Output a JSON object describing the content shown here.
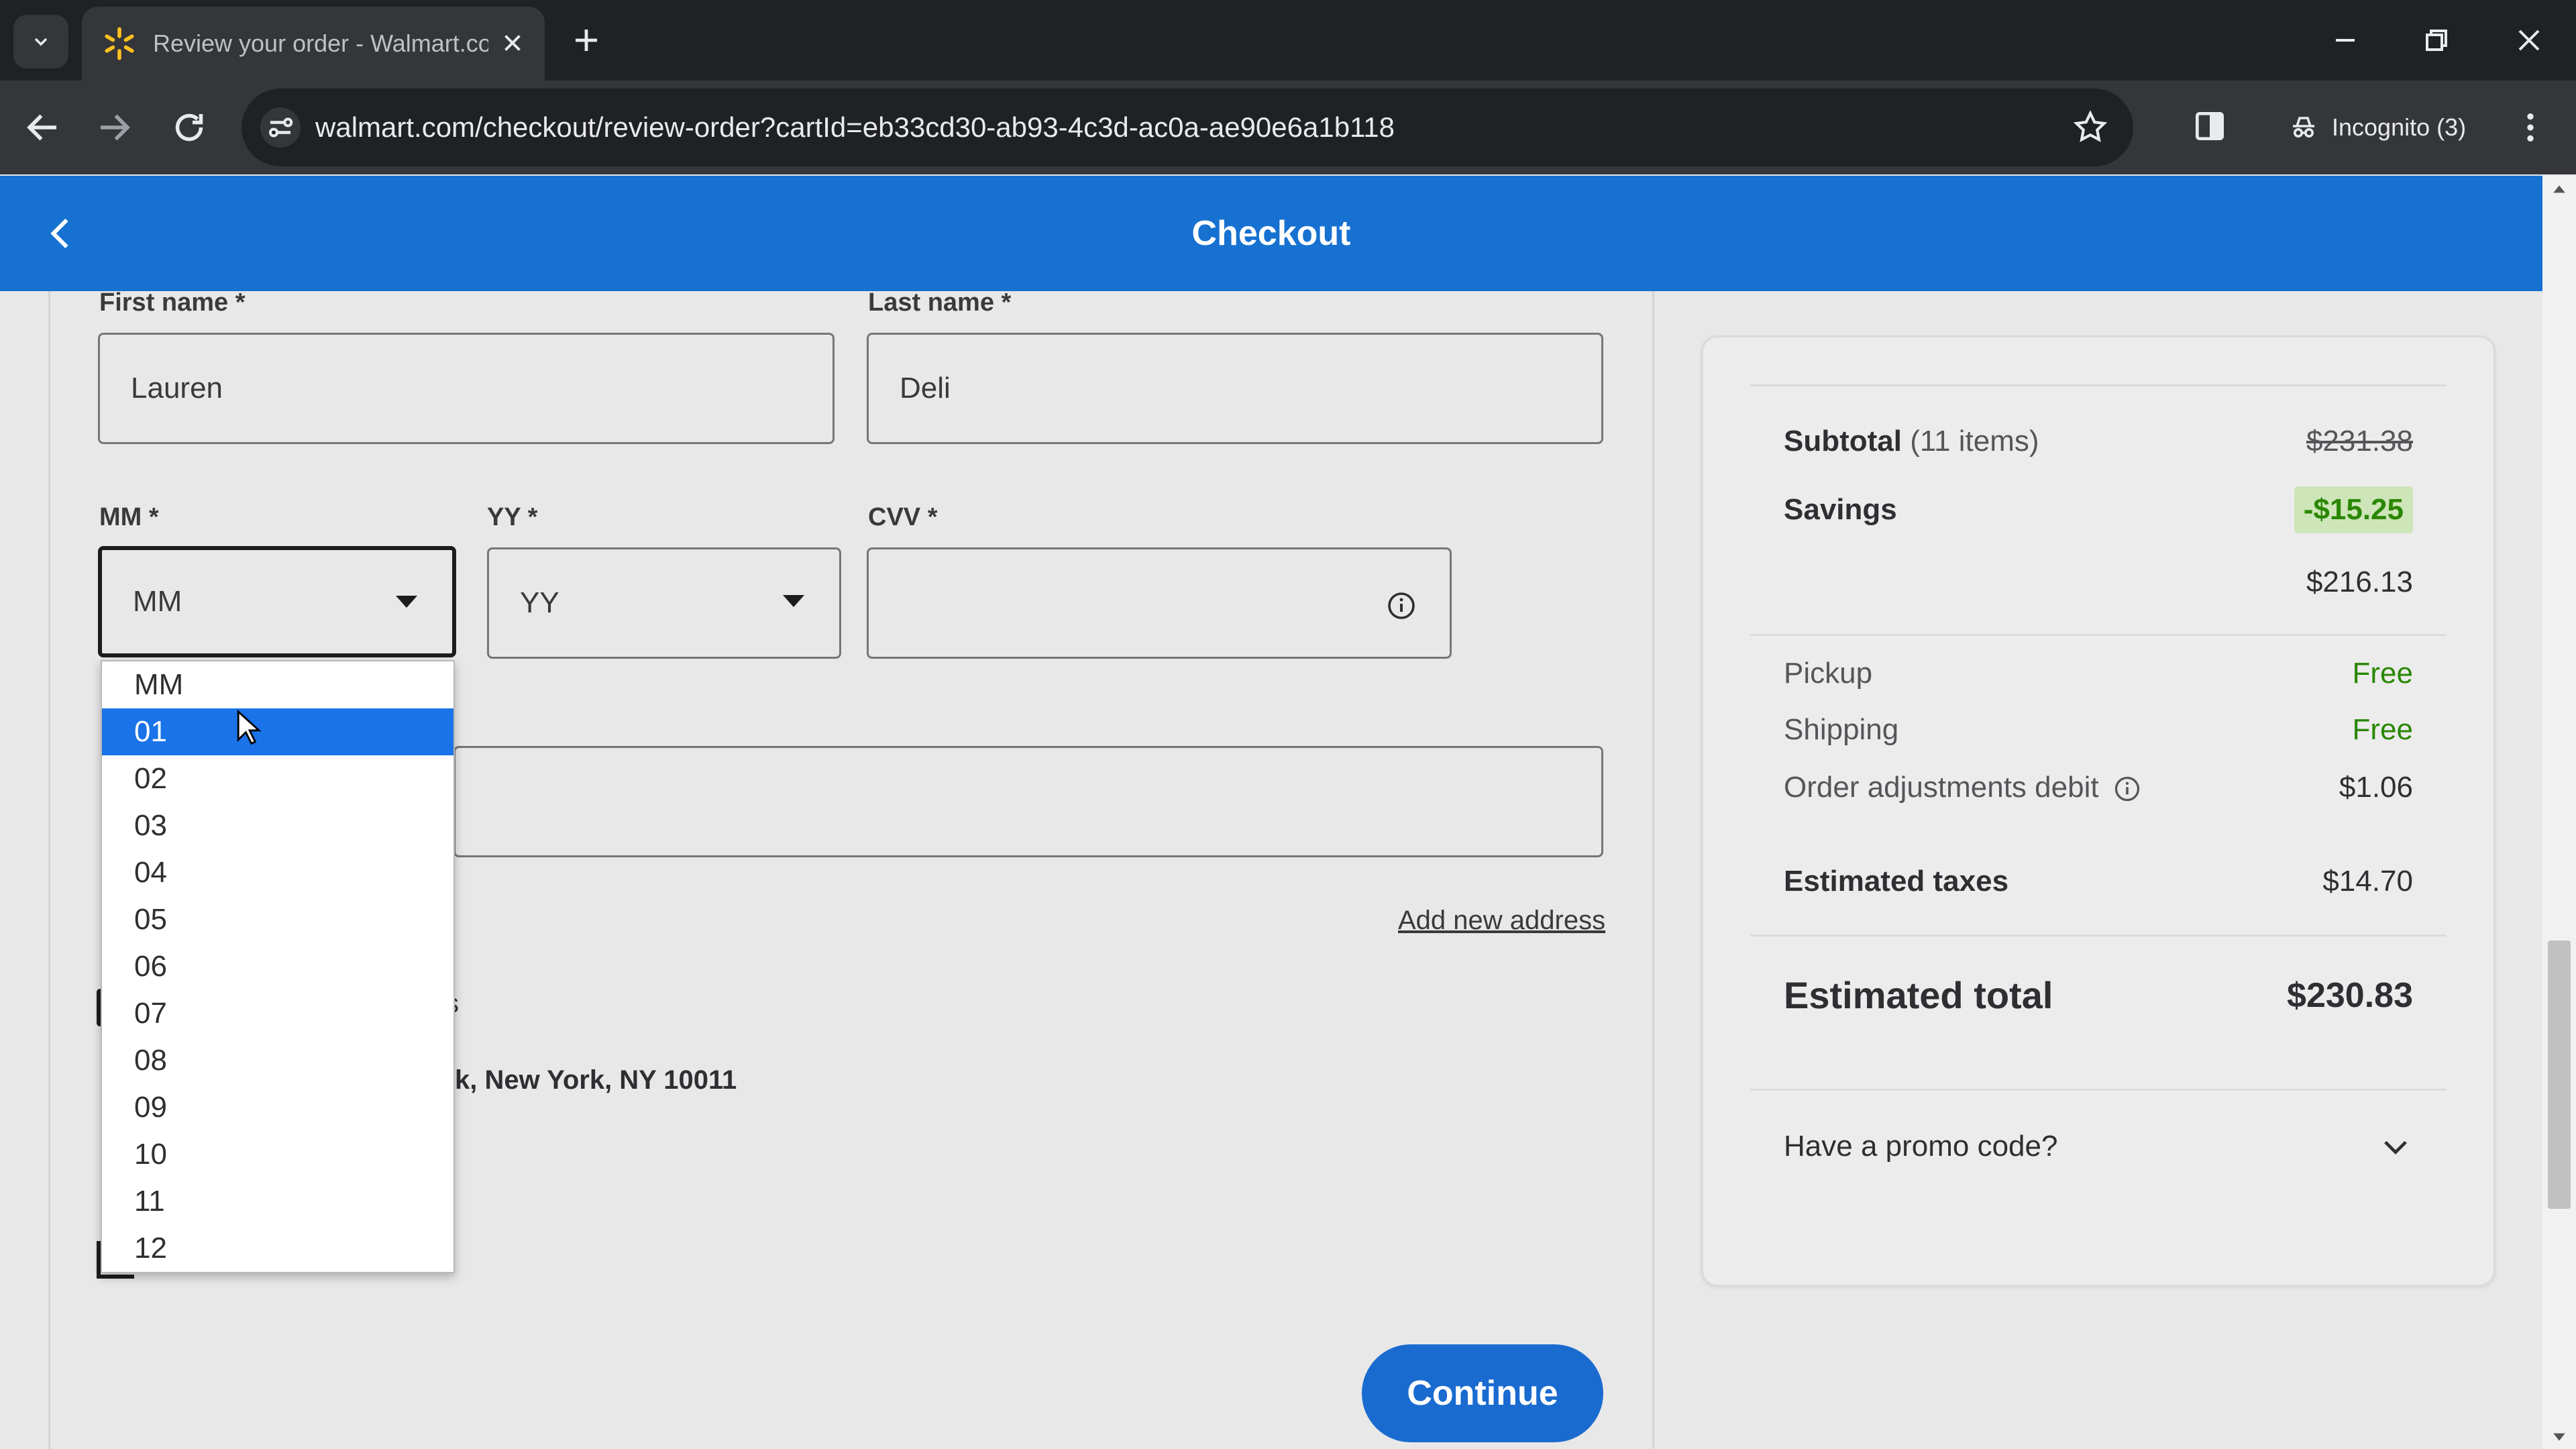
{
  "browser": {
    "tab_title": "Review your order - Walmart.com",
    "url": "walmart.com/checkout/review-order?cartId=eb33cd30-ab93-4c3d-ac0a-ae90e6a1b118",
    "incognito_label": "Incognito (3)"
  },
  "header": {
    "title": "Checkout"
  },
  "form": {
    "first_name_label": "First name *",
    "first_name_value": "Lauren",
    "last_name_label": "Last name *",
    "last_name_value": "Deli",
    "mm_label": "MM *",
    "mm_value": "MM",
    "yy_label": "YY *",
    "yy_value": "YY",
    "cvv_label": "CVV *",
    "cvv_value": "",
    "add_address_link": "Add new address",
    "address_fragment_1": "s",
    "address_fragment_2": "k, New York, NY 10011",
    "continue_label": "Continue"
  },
  "month_dropdown": {
    "options": [
      "MM",
      "01",
      "02",
      "03",
      "04",
      "05",
      "06",
      "07",
      "08",
      "09",
      "10",
      "11",
      "12"
    ],
    "highlighted": "01"
  },
  "summary": {
    "subtotal_label": "Subtotal",
    "subtotal_items": "(11 items)",
    "subtotal_value": "$231.38",
    "savings_label": "Savings",
    "savings_value": "-$15.25",
    "after_savings_value": "$216.13",
    "pickup_label": "Pickup",
    "pickup_value": "Free",
    "shipping_label": "Shipping",
    "shipping_value": "Free",
    "adjustments_label": "Order adjustments debit",
    "adjustments_value": "$1.06",
    "taxes_label": "Estimated taxes",
    "taxes_value": "$14.70",
    "total_label": "Estimated total",
    "total_value": "$230.83",
    "promo_label": "Have a promo code?"
  },
  "colors": {
    "header_blue": "#1671d1",
    "button_blue": "#1a6bd0",
    "savings_green": "#2a8703",
    "dropdown_highlight": "#1a73e8"
  }
}
